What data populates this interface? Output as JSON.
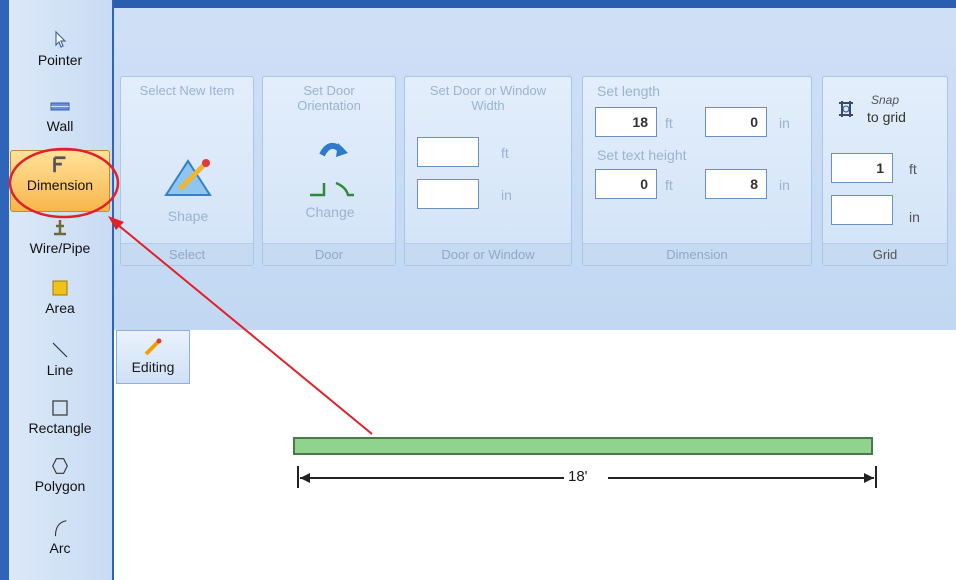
{
  "toolbar": {
    "items": [
      {
        "label": "Pointer",
        "icon": "pointer-icon"
      },
      {
        "label": "Wall",
        "icon": "wall-icon"
      },
      {
        "label": "Dimension",
        "icon": "dimension-icon",
        "active": true
      },
      {
        "label": "Wire/Pipe",
        "icon": "wire-pipe-icon"
      },
      {
        "label": "Area",
        "icon": "area-icon"
      },
      {
        "label": "Line",
        "icon": "line-icon"
      },
      {
        "label": "Rectangle",
        "icon": "rectangle-icon"
      },
      {
        "label": "Polygon",
        "icon": "polygon-icon"
      },
      {
        "label": "Arc",
        "icon": "arc-icon"
      }
    ]
  },
  "ribbon": {
    "select": {
      "title": "Select New Item",
      "button_label": "Shape",
      "caption": "Select"
    },
    "door": {
      "title": "Set Door Orientation",
      "button_label": "Change",
      "caption": "Door"
    },
    "door_window": {
      "title": "Set Door or Window Width",
      "ft_value": "",
      "in_value": "",
      "ft_unit": "ft",
      "in_unit": "in",
      "caption": "Door or Window"
    },
    "dimension": {
      "length_label": "Set length",
      "length_ft": "18",
      "length_in": "0",
      "text_height_label": "Set text height",
      "text_ft": "0",
      "text_in": "8",
      "ft_unit": "ft",
      "in_unit": "in",
      "caption": "Dimension"
    },
    "grid": {
      "snap_label_1": "Snap",
      "snap_label_2": "to grid",
      "ft_value": "1",
      "in_value": "",
      "ft_unit": "ft",
      "in_unit": "in",
      "caption": "Grid"
    }
  },
  "editing_tab": {
    "label": "Editing"
  },
  "canvas": {
    "dimension_text": "18'"
  },
  "colors": {
    "accent": "#2f65b8",
    "highlight": "#f8b64c",
    "annotation": "#e0212a",
    "wall_fill": "#8fd38f"
  }
}
